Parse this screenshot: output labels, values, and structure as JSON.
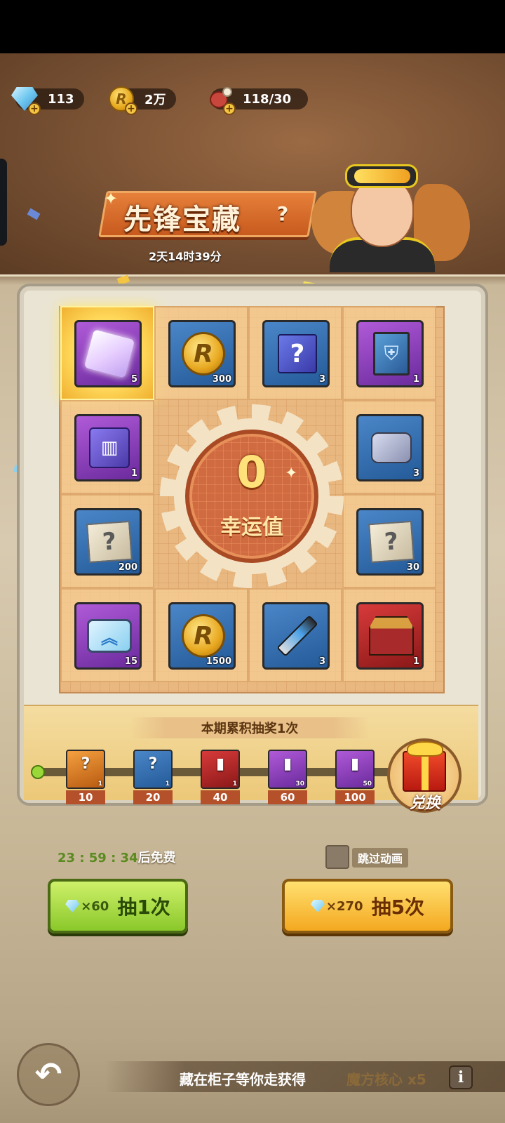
{
  "resources": [
    {
      "icon": "gem-icon",
      "value": "113"
    },
    {
      "icon": "coin-icon",
      "value": "2万"
    },
    {
      "icon": "meat-icon",
      "value": "118/30"
    }
  ],
  "header": {
    "title": "先锋宝藏",
    "help": "?",
    "countdown": "2天14时39分"
  },
  "board": {
    "cells": [
      {
        "art": "crystal-cube-icon",
        "count": "5",
        "rarity": "purple",
        "selected": true
      },
      {
        "art": "gold-coin-icon",
        "count": "300",
        "rarity": "blue"
      },
      {
        "art": "mystery-box-icon",
        "count": "3",
        "rarity": "blue"
      },
      {
        "art": "manual-book-icon",
        "count": "1",
        "rarity": "purple"
      },
      {
        "art": "chip-icon",
        "count": "1",
        "rarity": "purple"
      },
      {
        "art": "ore-icon",
        "count": "3",
        "rarity": "blue"
      },
      {
        "art": "treasure-map-icon",
        "count": "200",
        "rarity": "blue"
      },
      {
        "art": "treasure-map-icon",
        "count": "30",
        "rarity": "blue"
      },
      {
        "art": "upgrade-pad-icon",
        "count": "15",
        "rarity": "purple"
      },
      {
        "art": "gold-coin-icon",
        "count": "1500",
        "rarity": "blue"
      },
      {
        "art": "syringe-icon",
        "count": "3",
        "rarity": "blue"
      },
      {
        "art": "temple-icon",
        "count": "1",
        "rarity": "red"
      }
    ],
    "luck_value": "0",
    "luck_label": "幸运值"
  },
  "progress": {
    "title": "本期累积抽奖1次",
    "current": 1,
    "milestones": [
      {
        "label": "10",
        "qty": "1",
        "icon": "gift-box-icon",
        "color": "orange"
      },
      {
        "label": "20",
        "qty": "1",
        "icon": "mystery-crate-icon",
        "color": "blue"
      },
      {
        "label": "40",
        "qty": "1",
        "icon": "fuel-can-icon",
        "color": "red"
      },
      {
        "label": "60",
        "qty": "30",
        "icon": "shell-icon",
        "color": "purple"
      },
      {
        "label": "100",
        "qty": "50",
        "icon": "shell-icon",
        "color": "purple"
      }
    ],
    "exchange_label": "兑换"
  },
  "actions": {
    "timer": "23 : 59 : 34",
    "timer_suffix": "后免费",
    "skip_label": "跳过动画",
    "single": {
      "cost": "×60",
      "label": "抽1次"
    },
    "multi": {
      "cost": "×270",
      "label": "抽5次"
    }
  },
  "footer": {
    "tip": "藏在柜子等你走获得",
    "tip_highlight": "魔方核心 x5",
    "info": "i"
  },
  "colors": {
    "accent_orange": "#f4a820",
    "accent_green": "#8ac82a",
    "title_banner": "#c85a1e"
  }
}
